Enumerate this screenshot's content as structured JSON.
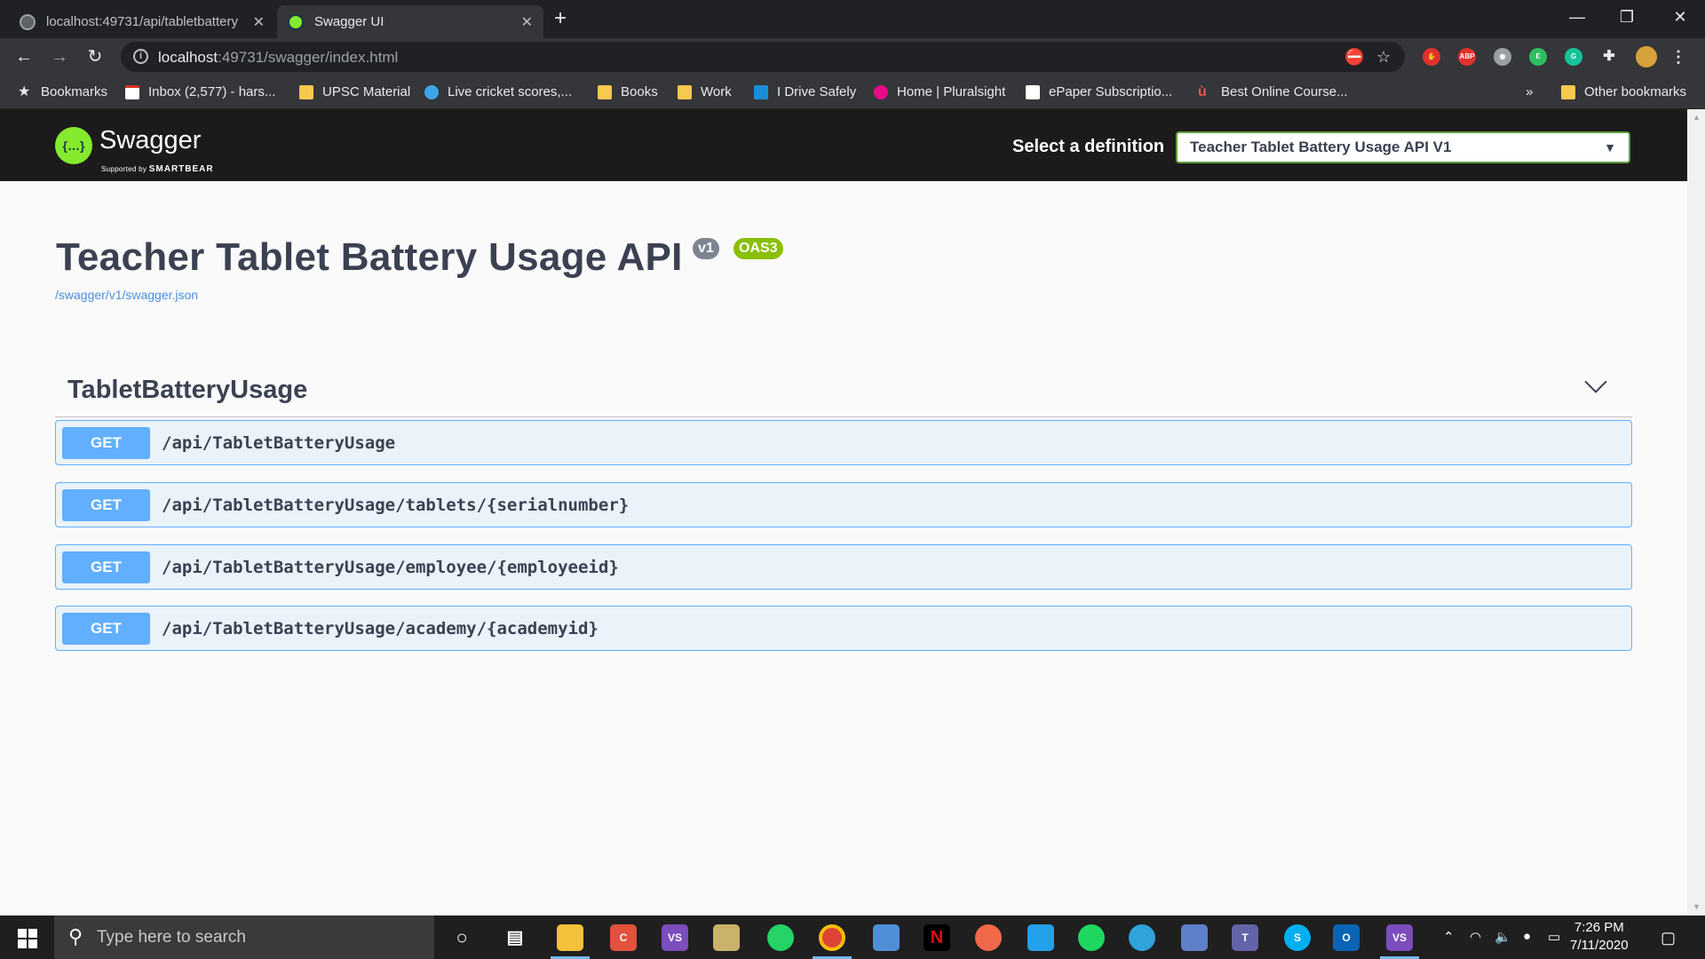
{
  "browser": {
    "tabs": [
      {
        "title": "localhost:49731/api/tabletbattery",
        "active": false
      },
      {
        "title": "Swagger UI",
        "active": true
      }
    ],
    "url_host": "localhost",
    "url_rest": ":49731/swagger/index.html",
    "bookmarks": [
      {
        "label": "Bookmarks",
        "icon": "star-icon"
      },
      {
        "label": "Inbox (2,577) - hars...",
        "icon": "gmail-icon"
      },
      {
        "label": "UPSC Material",
        "icon": "folder-icon"
      },
      {
        "label": "Live cricket scores,...",
        "icon": "globe-icon"
      },
      {
        "label": "Books",
        "icon": "folder-icon"
      },
      {
        "label": "Work",
        "icon": "folder-icon"
      },
      {
        "label": "I Drive Safely",
        "icon": "idrive-icon"
      },
      {
        "label": "Home | Pluralsight",
        "icon": "pluralsight-icon"
      },
      {
        "label": "ePaper Subscriptio...",
        "icon": "epaper-icon"
      },
      {
        "label": "Best Online Course...",
        "icon": "udemy-icon"
      }
    ],
    "overflow": "»",
    "other_bookmarks": "Other bookmarks"
  },
  "swagger": {
    "logo_text": "Swagger",
    "logo_sub": "Supported by",
    "logo_brand": "SMARTBEAR",
    "select_label": "Select a definition",
    "selected_definition": "Teacher Tablet Battery Usage API V1",
    "api_title": "Teacher Tablet Battery Usage API",
    "version_badge": "v1",
    "oas_badge": "OAS3",
    "spec_link": "/swagger/v1/swagger.json",
    "tag_name": "TabletBatteryUsage",
    "operations": [
      {
        "method": "GET",
        "path": "/api/TabletBatteryUsage"
      },
      {
        "method": "GET",
        "path": "/api/TabletBatteryUsage/tablets/{serialnumber}"
      },
      {
        "method": "GET",
        "path": "/api/TabletBatteryUsage/employee/{employeeid}"
      },
      {
        "method": "GET",
        "path": "/api/TabletBatteryUsage/academy/{academyid}"
      }
    ]
  },
  "taskbar": {
    "search_placeholder": "Type here to search",
    "time": "7:26 PM",
    "date": "7/11/2020"
  },
  "colors": {
    "swagger_green": "#85ea2d",
    "get_blue": "#61affe",
    "text_dark": "#3b4151",
    "oas_badge": "#89bf04",
    "version_badge": "#7d8492"
  }
}
